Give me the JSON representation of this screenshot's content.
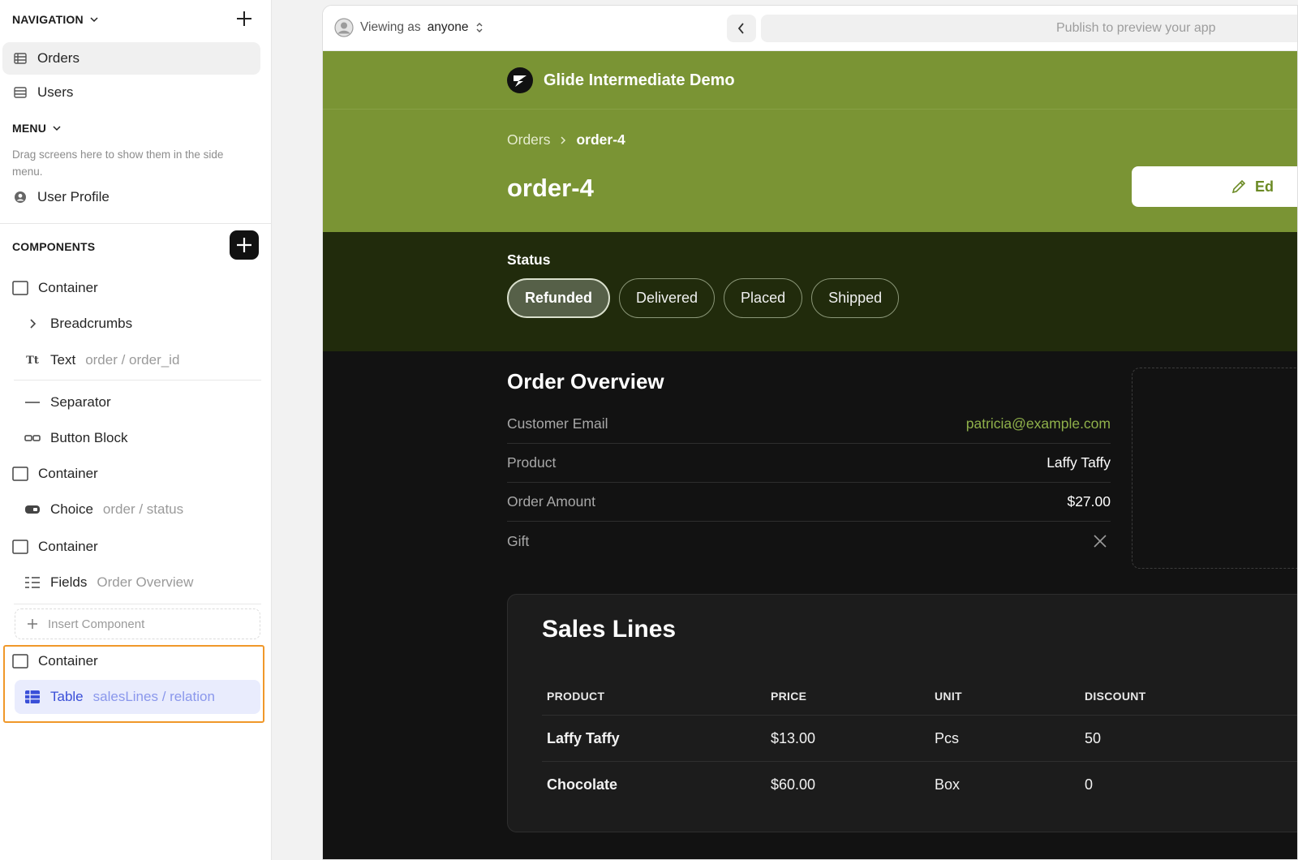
{
  "navigation": {
    "title": "NAVIGATION",
    "items": [
      {
        "label": "Orders",
        "icon": "table-icon"
      },
      {
        "label": "Users",
        "icon": "table-icon"
      }
    ]
  },
  "menu": {
    "title": "MENU",
    "hint": "Drag screens here to show them in the side menu.",
    "items": [
      {
        "label": "User Profile",
        "icon": "user-icon"
      }
    ]
  },
  "components": {
    "title": "COMPONENTS",
    "items": [
      {
        "label": "Container",
        "sub": ""
      },
      {
        "label": "Breadcrumbs",
        "sub": ""
      },
      {
        "label": "Text",
        "sub": "order / order_id"
      },
      {
        "label": "Separator",
        "sub": ""
      },
      {
        "label": "Button Block",
        "sub": ""
      },
      {
        "label": "Container",
        "sub": ""
      },
      {
        "label": "Choice",
        "sub": "order / status"
      },
      {
        "label": "Container",
        "sub": ""
      },
      {
        "label": "Fields",
        "sub": "Order Overview"
      },
      {
        "label": "Container",
        "sub": ""
      },
      {
        "label": "Table",
        "sub": "salesLines / relation"
      }
    ],
    "insert_label": "Insert Component"
  },
  "preview": {
    "viewing_prefix": "Viewing as",
    "viewing_role": "anyone",
    "url_placeholder": "Publish to preview your app",
    "app_title": "Glide Intermediate Demo",
    "breadcrumb": [
      "Orders",
      "order-4"
    ],
    "page_title": "order-4",
    "edit_label": "Ed",
    "status_label": "Status",
    "status_options": [
      "Refunded",
      "Delivered",
      "Placed",
      "Shipped"
    ],
    "status_selected": "Refunded",
    "overview_title": "Order Overview",
    "fields": [
      {
        "label": "Customer Email",
        "value": "patricia@example.com"
      },
      {
        "label": "Product",
        "value": "Laffy Taffy"
      },
      {
        "label": "Order Amount",
        "value": "$27.00"
      },
      {
        "label": "Gift",
        "value": ""
      }
    ],
    "sales_title": "Sales Lines",
    "table": {
      "columns": [
        "PRODUCT",
        "PRICE",
        "UNIT",
        "DISCOUNT"
      ],
      "rows": [
        [
          "Laffy Taffy",
          "$13.00",
          "Pcs",
          "50"
        ],
        [
          "Chocolate",
          "$60.00",
          "Box",
          "0"
        ]
      ]
    }
  },
  "colors": {
    "accent_green": "#7a9434",
    "status_bg": "#212b0c",
    "highlight_orange": "#f0982a",
    "selected_blue": "#3a4fd8"
  }
}
